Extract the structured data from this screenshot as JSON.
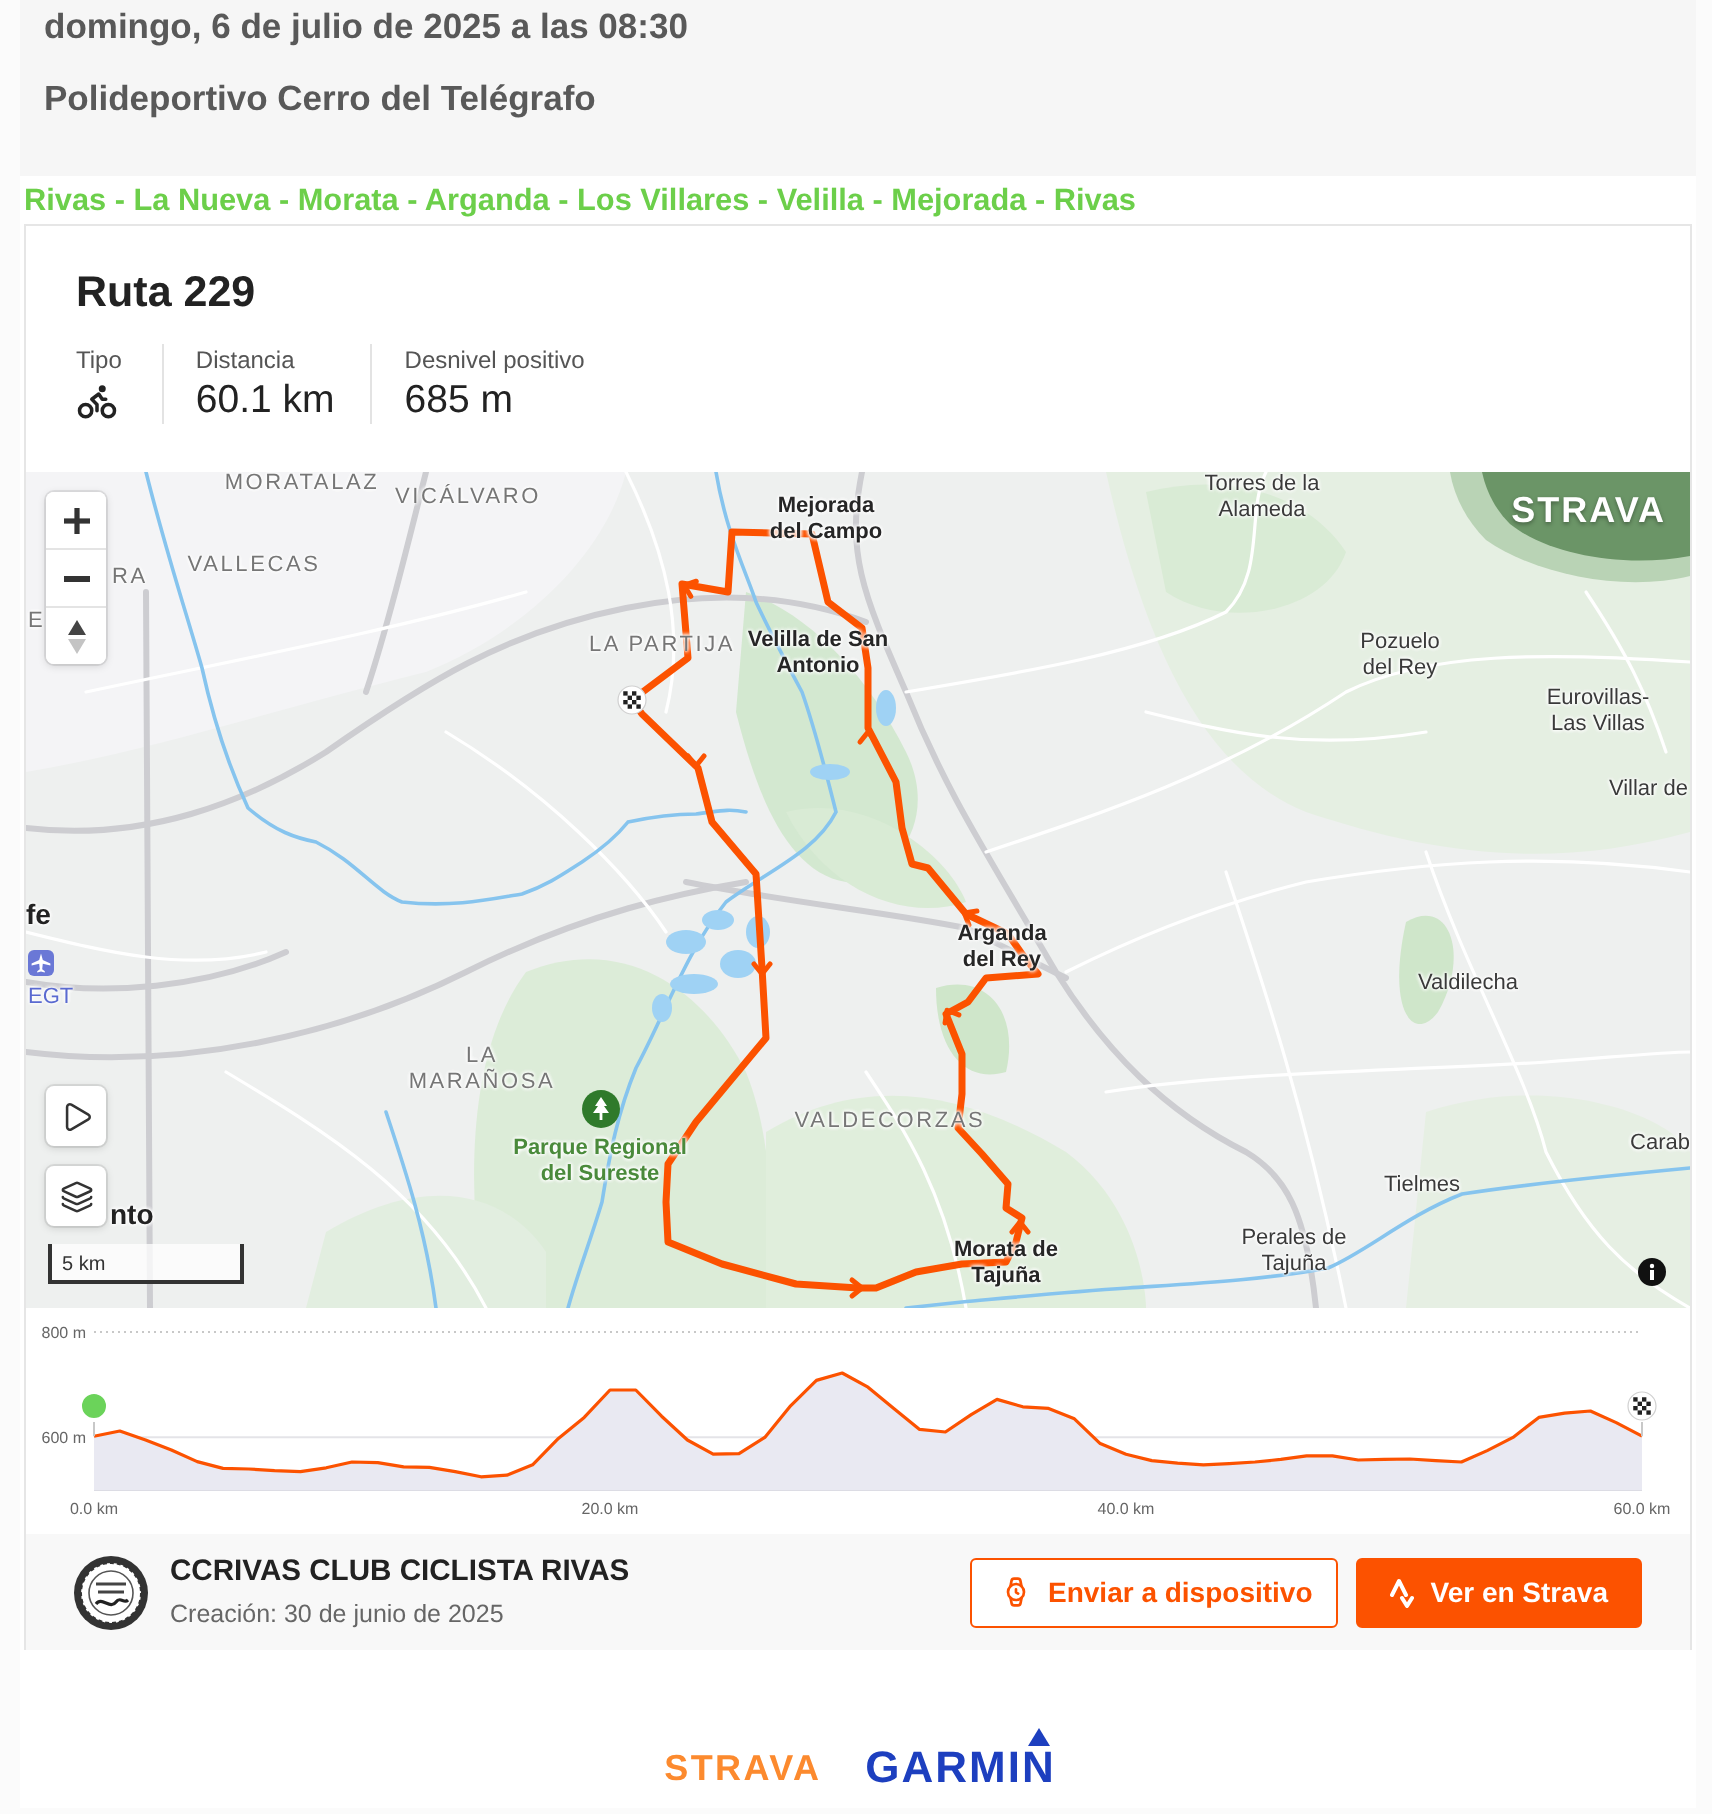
{
  "header": {
    "date": "domingo, 6 de julio de 2025 a las 08:30",
    "place": "Polideportivo Cerro del Telégrafo"
  },
  "route_link": "Rivas - La Nueva - Morata - Arganda - Los Villares - Velilla - Mejorada - Rivas",
  "route": {
    "title": "Ruta 229",
    "stats": [
      {
        "kind": "icon",
        "label": "Tipo"
      },
      {
        "kind": "text",
        "label": "Distancia",
        "value": "60.1 km"
      },
      {
        "kind": "text",
        "label": "Desnivel positivo",
        "value": "685 m"
      }
    ]
  },
  "map": {
    "logo": "STRAVA",
    "labels": [
      {
        "kind": "district",
        "lines": [
          "MORATALAZ"
        ]
      },
      {
        "kind": "district",
        "lines": [
          "VICÁLVARO"
        ]
      },
      {
        "kind": "town_major",
        "lines": [
          "Mejorada",
          "del Campo"
        ]
      },
      {
        "kind": "town",
        "lines": [
          "Torres de la",
          "Alameda"
        ]
      },
      {
        "kind": "district",
        "lines": [
          "RA"
        ]
      },
      {
        "kind": "district",
        "lines": [
          "VALLECAS"
        ]
      },
      {
        "kind": "district",
        "lines": [
          "E"
        ]
      },
      {
        "kind": "district",
        "lines": [
          "LA PARTIJA"
        ]
      },
      {
        "kind": "town_major",
        "lines": [
          "Velilla de San",
          "Antonio"
        ]
      },
      {
        "kind": "town",
        "lines": [
          "Pozuelo",
          "del Rey"
        ]
      },
      {
        "kind": "town",
        "lines": [
          "Eurovillas-",
          "Las Villas"
        ]
      },
      {
        "kind": "town",
        "lines": [
          "Villar de"
        ]
      },
      {
        "kind": "city",
        "lines": [
          "fe"
        ]
      },
      {
        "kind": "town_major",
        "lines": [
          "Arganda",
          "del Rey"
        ]
      },
      {
        "kind": "airport",
        "lines": [
          "EGT"
        ]
      },
      {
        "kind": "town",
        "lines": [
          "Valdilecha"
        ]
      },
      {
        "kind": "district",
        "lines": [
          "LA",
          "MARAÑOSA"
        ]
      },
      {
        "kind": "district",
        "lines": [
          "VALDECORZAS"
        ]
      },
      {
        "kind": "park",
        "lines": [
          "Parque Regional",
          "del Sureste"
        ]
      },
      {
        "kind": "town",
        "lines": [
          "Carab"
        ]
      },
      {
        "kind": "city",
        "lines": [
          "nto"
        ]
      },
      {
        "kind": "town",
        "lines": [
          "Tielmes"
        ]
      },
      {
        "kind": "town_major",
        "lines": [
          "Morata de",
          "Tajuña"
        ]
      },
      {
        "kind": "town",
        "lines": [
          "Perales de",
          "Tajuña"
        ]
      }
    ],
    "scale": "5 km"
  },
  "elevation": {
    "chart_data": {
      "type": "area",
      "x": [
        0,
        1,
        2,
        3,
        4,
        5,
        6,
        7,
        8,
        9,
        10,
        11,
        12,
        13,
        14,
        15,
        16,
        17,
        18,
        19,
        20,
        21,
        22,
        23,
        24,
        25,
        26,
        27,
        28,
        29,
        30,
        31,
        32,
        33,
        34,
        35,
        36,
        37,
        38,
        39,
        40,
        41,
        42,
        43,
        44,
        45,
        46,
        47,
        48,
        49,
        50,
        51,
        52,
        53,
        54,
        55,
        56,
        57,
        58,
        59,
        60
      ],
      "series": [
        {
          "color": "#fc5200",
          "values": [
            602,
            612,
            595,
            576,
            554,
            541,
            540,
            537,
            535,
            542,
            553,
            552,
            544,
            543,
            535,
            525,
            528,
            548,
            598,
            638,
            690,
            690,
            640,
            595,
            568,
            569,
            600,
            660,
            708,
            722,
            695,
            655,
            615,
            610,
            643,
            672,
            658,
            655,
            635,
            588,
            568,
            556,
            551,
            548,
            550,
            553,
            558,
            565,
            565,
            557,
            558,
            559,
            556,
            553,
            575,
            600,
            638,
            646,
            650,
            628,
            602
          ]
        }
      ],
      "xlim": [
        0,
        60
      ],
      "ylim": [
        500,
        800
      ],
      "xticks": [
        {
          "value": 0,
          "label": "0.0 km"
        },
        {
          "value": 20,
          "label": "20.0 km"
        },
        {
          "value": 40,
          "label": "40.0 km"
        },
        {
          "value": 60,
          "label": "60.0 km"
        }
      ],
      "yticks": [
        {
          "value": 600,
          "label": "600 m"
        },
        {
          "value": 800,
          "label": "800 m"
        }
      ]
    }
  },
  "club": {
    "name": "CCRIVAS CLUB CICLISTA RIVAS",
    "created": "Creación: 30 de junio de 2025"
  },
  "buttons": [
    {
      "kind": "outline",
      "label": "Enviar a dispositivo"
    },
    {
      "kind": "primary",
      "label": "Ver en Strava"
    }
  ],
  "partners": [
    {
      "kind": "strava",
      "text": "STRAVA"
    },
    {
      "kind": "garmin",
      "text": "GARMIN"
    }
  ]
}
